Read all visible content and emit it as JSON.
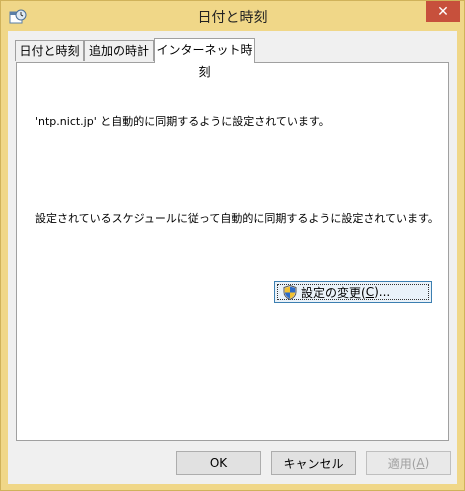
{
  "window": {
    "title": "日付と時刻",
    "close_glyph": "✕"
  },
  "tabs": [
    {
      "label": "日付と時刻",
      "active": false
    },
    {
      "label": "追加の時計",
      "active": false
    },
    {
      "label": "インターネット時刻",
      "active": true
    }
  ],
  "panel": {
    "sync_message": "'ntp.nict.jp' と自動的に同期するように設定されています。",
    "schedule_message": "設定されているスケジュールに従って自動的に同期するように設定されています。",
    "change_settings": {
      "label": "設定の変更(",
      "accel": "C",
      "suffix": ")...",
      "icon": "uac-shield-icon"
    }
  },
  "buttons": {
    "ok": "OK",
    "cancel": "キャンセル",
    "apply": {
      "label": "適用(",
      "accel": "A",
      "suffix": ")",
      "enabled": false
    }
  }
}
